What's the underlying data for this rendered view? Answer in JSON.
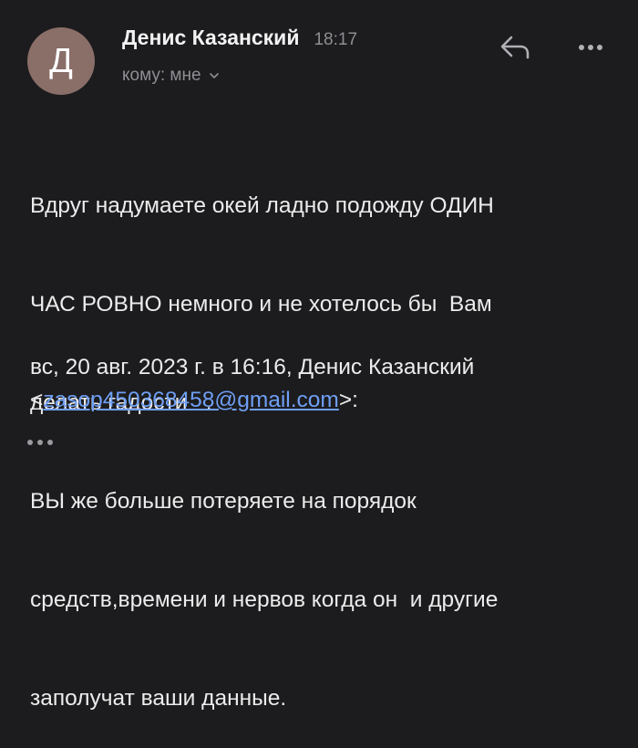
{
  "header": {
    "avatar_letter": "Д",
    "sender_name": "Денис Казанский",
    "time": "18:17",
    "recipient_label": "кому: мне"
  },
  "icons": {
    "reply": "reply-icon",
    "more": "more-vertical-dots-icon",
    "chevron": "chevron-down-icon",
    "ellipsis": "ellipsis-icon"
  },
  "colors": {
    "background": "#1c1c1e",
    "avatar": "#8a6e68",
    "link": "#6f9ff5",
    "muted": "#8e8e93"
  },
  "message": {
    "lines": [
      "Вдруг надумаете окей ладно подожду ОДИН",
      "ЧАС РОВНО немного и не хотелось бы  Вам",
      "делать гадости   .",
      "ВЫ же больше потеряете на порядок",
      "средств,времени и нервов когда он  и другие",
      "заполучат ваши данные."
    ]
  },
  "quote": {
    "header_text": "вс, 20 авг. 2023 г. в 16:16, Денис Казанский",
    "open_bracket": "<",
    "email": "zasop450368458@gmail.com",
    "close_bracket": ">:"
  }
}
